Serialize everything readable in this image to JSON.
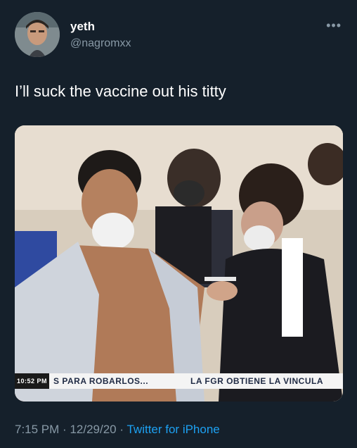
{
  "user": {
    "name": "yeth",
    "handle": "@nagromxx"
  },
  "tweet": {
    "text": "I’ll suck the vaccine out his titty"
  },
  "media": {
    "chyron_time": "10:52 PM",
    "chyron_text_left": "S PARA ROBARLOS...",
    "chyron_text_right": "LA FGR OBTIENE LA VINCULA"
  },
  "meta": {
    "time": "7:15 PM",
    "separator": "·",
    "date": "12/29/20",
    "source": "Twitter for iPhone"
  },
  "icons": {
    "more": "more-icon"
  }
}
